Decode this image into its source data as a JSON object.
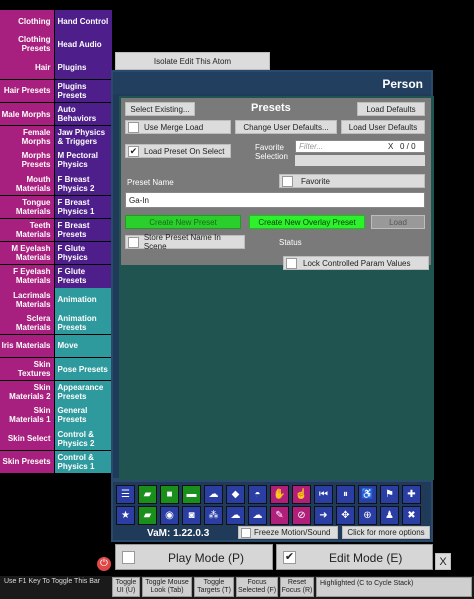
{
  "categories": [
    {
      "left": "Clothing",
      "right": "Hand Control",
      "lc": "pink",
      "rc": "purple"
    },
    {
      "left": "Clothing Presets",
      "right": "Head Audio",
      "lc": "pink",
      "rc": "purple"
    },
    {
      "left": "Hair",
      "right": "Plugins",
      "lc": "pink",
      "rc": "purple"
    },
    {
      "left": "Hair Presets",
      "right": "Plugins Presets",
      "lc": "pink",
      "rc": "purple"
    },
    {
      "left": "Male Morphs",
      "right": "Auto Behaviors",
      "lc": "pink",
      "rc": "purple"
    },
    {
      "left": "Female Morphs",
      "right": "Jaw Physics & Triggers",
      "lc": "pink",
      "rc": "purple"
    },
    {
      "left": "Morphs Presets",
      "right": "M Pectoral Physics",
      "lc": "pink",
      "rc": "purple"
    },
    {
      "left": "Mouth Materials",
      "right": "F Breast Physics 2",
      "lc": "pink",
      "rc": "purple"
    },
    {
      "left": "Tongue Materials",
      "right": "F Breast Physics 1",
      "lc": "pink",
      "rc": "purple"
    },
    {
      "left": "Teeth Materials",
      "right": "F Breast Presets",
      "lc": "pink",
      "rc": "purple"
    },
    {
      "left": "M Eyelash Materials",
      "right": "F Glute Physics",
      "lc": "pink",
      "rc": "purple"
    },
    {
      "left": "F Eyelash Materials",
      "right": "F Glute Presets",
      "lc": "pink",
      "rc": "purple"
    },
    {
      "left": "Lacrimals Materials",
      "right": "Animation",
      "lc": "pink",
      "rc": "teal"
    },
    {
      "left": "Sclera Materials",
      "right": "Animation Presets",
      "lc": "pink",
      "rc": "teal"
    },
    {
      "left": "Iris Materials",
      "right": "Move",
      "lc": "pink",
      "rc": "teal"
    },
    {
      "left": "Skin Textures",
      "right": "Pose Presets",
      "lc": "pink",
      "rc": "teal"
    },
    {
      "left": "Skin Materials 2",
      "right": "Appearance Presets",
      "lc": "pink",
      "rc": "teal"
    },
    {
      "left": "Skin Materials 1",
      "right": "General Presets",
      "lc": "pink",
      "rc": "teal"
    },
    {
      "left": "Skin Select",
      "right": "Control & Physics 2",
      "lc": "pink",
      "rc": "teal"
    },
    {
      "left": "Skin Presets",
      "right": "Control & Physics 1",
      "lc": "pink",
      "rc": "teal"
    }
  ],
  "isolate_label": "Isolate Edit This Atom",
  "atom_title": "Person",
  "presets": {
    "select_existing": "Select Existing...",
    "title": "Presets",
    "load_defaults": "Load Defaults",
    "use_merge_load": "Use Merge Load",
    "change_user_defaults": "Change User Defaults...",
    "load_user_defaults": "Load User Defaults",
    "load_preset_on_select": "Load Preset On Select",
    "favorite_selection": "Favorite Selection",
    "filter_placeholder": "Filter...",
    "filter_clear": "X",
    "filter_count": "0 / 0",
    "preset_name_label": "Preset Name",
    "favorite": "Favorite",
    "preset_name_value": "Ga-In",
    "create_new_preset": "Create New Preset",
    "create_new_overlay": "Create New Overlay Preset",
    "load": "Load",
    "store_name_in_scene": "Store Preset Name In Scene",
    "status": "Status",
    "lock_params": "Lock Controlled Param Values"
  },
  "toolbar": {
    "row1": [
      {
        "name": "menu-icon",
        "glyph": "☰",
        "c": ""
      },
      {
        "name": "open-folder-icon",
        "glyph": "▰",
        "c": "g"
      },
      {
        "name": "folder-icon",
        "glyph": "■",
        "c": "g"
      },
      {
        "name": "save-icon",
        "glyph": "▬",
        "c": "g"
      },
      {
        "name": "cloud-upload-icon",
        "glyph": "☁",
        "c": ""
      },
      {
        "name": "cube-icon",
        "glyph": "◆",
        "c": ""
      },
      {
        "name": "hat-icon",
        "glyph": "◓",
        "c": ""
      },
      {
        "name": "hand-icon",
        "glyph": "✋",
        "c": "m"
      },
      {
        "name": "hand-pointer-icon",
        "glyph": "☝",
        "c": "m"
      },
      {
        "name": "skip-back-icon",
        "glyph": "⏮",
        "c": ""
      },
      {
        "name": "pause-icon",
        "glyph": "⏸",
        "c": ""
      },
      {
        "name": "accessibility-icon",
        "glyph": "♿",
        "c": ""
      },
      {
        "name": "flag-icon",
        "glyph": "⚑",
        "c": ""
      },
      {
        "name": "plus-icon",
        "glyph": "✚",
        "c": ""
      }
    ],
    "row2": [
      {
        "name": "star-icon",
        "glyph": "★",
        "c": ""
      },
      {
        "name": "folder-open-icon",
        "glyph": "▰",
        "c": "g"
      },
      {
        "name": "vr-headset-icon",
        "glyph": "◉",
        "c": ""
      },
      {
        "name": "camera-icon",
        "glyph": "◙",
        "c": ""
      },
      {
        "name": "nodes-icon",
        "glyph": "⁂",
        "c": ""
      },
      {
        "name": "cloud-icon",
        "glyph": "☁",
        "c": ""
      },
      {
        "name": "cloud-check-icon",
        "glyph": "☁",
        "c": ""
      },
      {
        "name": "edit-icon",
        "glyph": "✎",
        "c": "m"
      },
      {
        "name": "no-hand-icon",
        "glyph": "⊘",
        "c": "m"
      },
      {
        "name": "arrow-right-icon",
        "glyph": "➜",
        "c": ""
      },
      {
        "name": "navigation-icon",
        "glyph": "✥",
        "c": ""
      },
      {
        "name": "target-icon",
        "glyph": "⊕",
        "c": ""
      },
      {
        "name": "person-icon",
        "glyph": "♟",
        "c": ""
      },
      {
        "name": "tools-icon",
        "glyph": "✖",
        "c": ""
      }
    ]
  },
  "vam_version": "VaM: 1.22.0.3",
  "freeze_motion": "Freeze Motion/Sound",
  "more_options": "Click for more options",
  "play_mode": "Play Mode (P)",
  "edit_mode": "Edit Mode (E)",
  "close_x": "X",
  "bottom": {
    "hint": "Use F1 Key To Toggle This Bar",
    "toggle_ui": "Toggle UI (U)",
    "toggle_mouse_look": "Toggle Mouse Look (Tab)",
    "toggle_targets": "Toggle Targets (T)",
    "focus_selected": "Focus Selected (F)",
    "reset_focus": "Reset Focus (R)",
    "highlighted": "Highlighted (C to Cycle Stack)"
  }
}
